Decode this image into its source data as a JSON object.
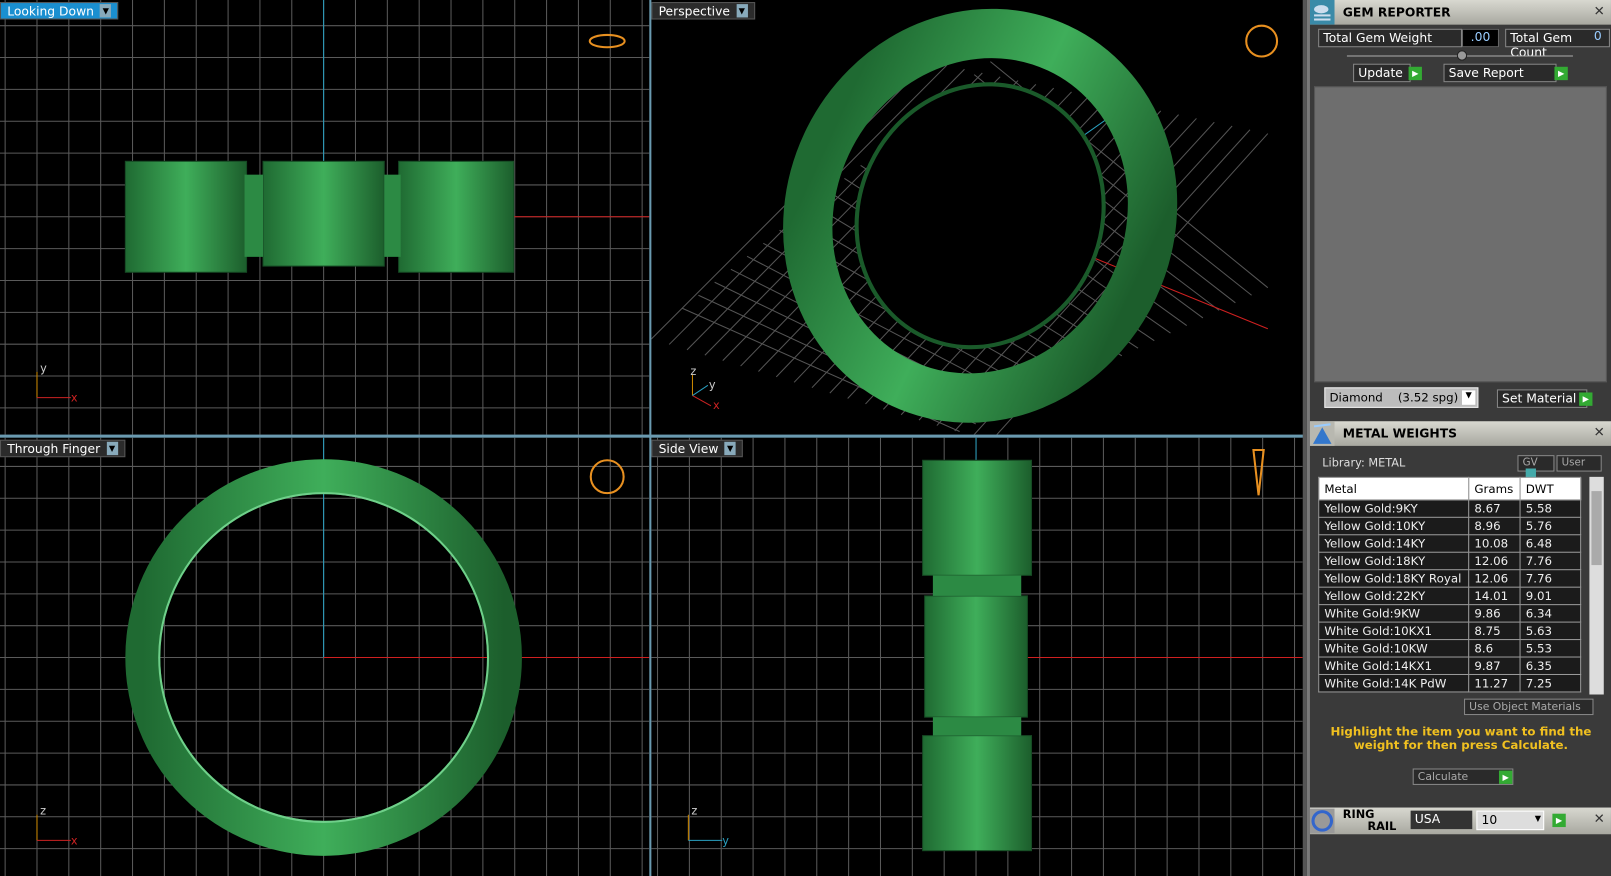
{
  "viewports": [
    {
      "label": "Looking Down",
      "active": true,
      "axes": [
        "y",
        "x"
      ]
    },
    {
      "label": "Perspective",
      "active": false,
      "axes": [
        "z",
        "y",
        "x"
      ]
    },
    {
      "label": "Through Finger",
      "active": false,
      "axes": [
        "z",
        "x"
      ]
    },
    {
      "label": "Side View",
      "active": false,
      "axes": [
        "z",
        "y"
      ]
    }
  ],
  "model_color": "#3fae5a",
  "gem_reporter": {
    "title": "GEM REPORTER",
    "total_weight_label": "Total Gem Weight",
    "total_weight": ".00",
    "total_count_label": "Total Gem Count",
    "total_count": "0",
    "update_label": "Update",
    "save_report_label": "Save Report",
    "material_select": "Diamond    (3.52 spg)",
    "set_material_label": "Set Material"
  },
  "metal_weights": {
    "title": "METAL WEIGHTS",
    "library": "Library: METAL",
    "gv_label": "GV",
    "user_label": "User",
    "columns": [
      "Metal",
      "Grams",
      "DWT"
    ],
    "rows": [
      [
        "Yellow Gold:9KY",
        "8.67",
        "5.58"
      ],
      [
        "Yellow Gold:10KY",
        "8.96",
        "5.76"
      ],
      [
        "Yellow Gold:14KY",
        "10.08",
        "6.48"
      ],
      [
        "Yellow Gold:18KY",
        "12.06",
        "7.76"
      ],
      [
        "Yellow Gold:18KY Royal",
        "12.06",
        "7.76"
      ],
      [
        "Yellow Gold:22KY",
        "14.01",
        "9.01"
      ],
      [
        "White Gold:9KW",
        "9.86",
        "6.34"
      ],
      [
        "White Gold:10KX1",
        "8.75",
        "5.63"
      ],
      [
        "White Gold:10KW",
        "8.6",
        "5.53"
      ],
      [
        "White Gold:14KX1",
        "9.87",
        "6.35"
      ],
      [
        "White Gold:14K PdW",
        "11.27",
        "7.25"
      ]
    ],
    "use_object_materials": "Use Object Materials",
    "hint": "Highlight the item you want to find the weight for then press Calculate.",
    "calculate_label": "Calculate"
  },
  "ring_rail": {
    "title_1": "RING",
    "title_2": "RAIL",
    "standard": "USA",
    "size": "10"
  }
}
